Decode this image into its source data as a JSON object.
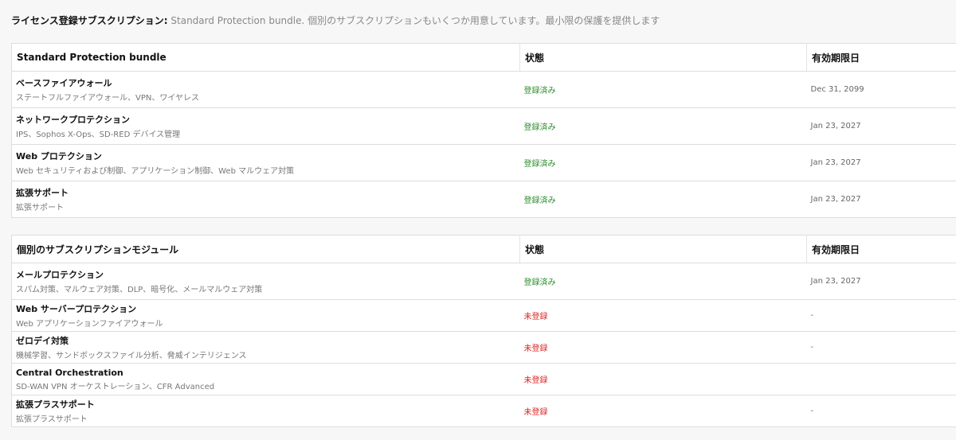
{
  "intro": {
    "label": "ライセンス登録サブスクリプション:",
    "text": "Standard Protection bundle. 個別のサブスクリプションもいくつか用意しています。最小限の保護を提供します"
  },
  "bundle": {
    "headers": [
      "Standard Protection bundle",
      "状態",
      "有効期限日"
    ],
    "rows": [
      {
        "name": "ベースファイアウォール",
        "desc": "ステートフルファイアウォール、VPN、ワイヤレス",
        "status": "登録済み",
        "expiry": "Dec 31, 2099"
      },
      {
        "name": "ネットワークプロテクション",
        "desc": "IPS、Sophos X-Ops、SD-RED デバイス管理",
        "status": "登録済み",
        "expiry": "Jan 23, 2027"
      },
      {
        "name": "Web プロテクション",
        "desc": "Web セキュリティおよび制御、アプリケーション制御、Web マルウェア対策",
        "status": "登録済み",
        "expiry": "Jan 23, 2027"
      },
      {
        "name": "拡張サポート",
        "desc": "拡張サポート",
        "status": "登録済み",
        "expiry": "Jan 23, 2027"
      }
    ]
  },
  "modules": {
    "headers": [
      "個別のサブスクリプションモジュール",
      "状態",
      "有効期限日"
    ],
    "rows": [
      {
        "name": "メールプロテクション",
        "desc": "スパム対策、マルウェア対策、DLP、暗号化、メールマルウェア対策",
        "status": "登録済み",
        "expiry": "Jan 23, 2027",
        "ok": true
      },
      {
        "name": "Web サーバープロテクション",
        "desc": "Web アプリケーションファイアウォール",
        "status": "未登録",
        "expiry": "-",
        "ok": false
      },
      {
        "name": "ゼロデイ対策",
        "desc": "機械学習、サンドボックスファイル分析、脅威インテリジェンス",
        "status": "未登録",
        "expiry": "-",
        "ok": false
      },
      {
        "name": "Central Orchestration",
        "desc": "SD-WAN VPN オーケストレーション、CFR Advanced",
        "status": "未登録",
        "expiry": "",
        "ok": false
      },
      {
        "name": "拡張プラスサポート",
        "desc": "拡張プラスサポート",
        "status": "未登録",
        "expiry": "-",
        "ok": false
      }
    ]
  },
  "colors": {
    "ok": "#2a8a2a",
    "ng": "#dd2222"
  }
}
